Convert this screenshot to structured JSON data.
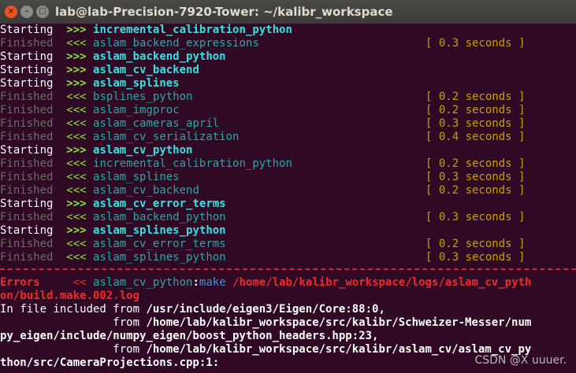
{
  "window": {
    "title": "lab@lab-Precision-7920-Tower: ~/kalibr_workspace",
    "close_icon": "×",
    "minimize_icon": "–",
    "maximize_icon": "□"
  },
  "colors": {
    "background": "#300a24",
    "accent_green": "#8ae234",
    "cyan": "#34e2e2",
    "error_red": "#ef2929",
    "seconds_yellow": "#c4a000"
  },
  "build_lines": [
    {
      "status": "Starting",
      "arrow": ">>>",
      "package": "incremental_calibration_python",
      "time": ""
    },
    {
      "status": "Finished",
      "arrow": "<<<",
      "package": "aslam_backend_expressions",
      "time": "[ 0.3 seconds ]"
    },
    {
      "status": "Starting",
      "arrow": ">>>",
      "package": "aslam_backend_python",
      "time": ""
    },
    {
      "status": "Starting",
      "arrow": ">>>",
      "package": "aslam_cv_backend",
      "time": ""
    },
    {
      "status": "Starting",
      "arrow": ">>>",
      "package": "aslam_splines",
      "time": ""
    },
    {
      "status": "Finished",
      "arrow": "<<<",
      "package": "bsplines_python",
      "time": "[ 0.2 seconds ]"
    },
    {
      "status": "Finished",
      "arrow": "<<<",
      "package": "aslam_imgproc",
      "time": "[ 0.2 seconds ]"
    },
    {
      "status": "Finished",
      "arrow": "<<<",
      "package": "aslam_cameras_april",
      "time": "[ 0.3 seconds ]"
    },
    {
      "status": "Finished",
      "arrow": "<<<",
      "package": "aslam_cv_serialization",
      "time": "[ 0.4 seconds ]"
    },
    {
      "status": "Starting",
      "arrow": ">>>",
      "package": "aslam_cv_python",
      "time": ""
    },
    {
      "status": "Finished",
      "arrow": "<<<",
      "package": "incremental_calibration_python",
      "time": "[ 0.2 seconds ]"
    },
    {
      "status": "Finished",
      "arrow": "<<<",
      "package": "aslam_splines",
      "time": "[ 0.3 seconds ]"
    },
    {
      "status": "Finished",
      "arrow": "<<<",
      "package": "aslam_cv_backend",
      "time": "[ 0.2 seconds ]"
    },
    {
      "status": "Starting",
      "arrow": ">>>",
      "package": "aslam_cv_error_terms",
      "time": ""
    },
    {
      "status": "Finished",
      "arrow": "<<<",
      "package": "aslam_backend_python",
      "time": "[ 0.3 seconds ]"
    },
    {
      "status": "Starting",
      "arrow": ">>>",
      "package": "aslam_splines_python",
      "time": ""
    },
    {
      "status": "Finished",
      "arrow": "<<<",
      "package": "aslam_cv_error_terms",
      "time": "[ 0.2 seconds ]"
    },
    {
      "status": "Finished",
      "arrow": "<<<",
      "package": "aslam_splines_python",
      "time": "[ 0.3 seconds ]"
    }
  ],
  "error": {
    "label": "Errors",
    "arrow": "<<",
    "package": "aslam_cv_python",
    "colon": ":",
    "target": "make",
    "path_line1": "/home/lab/kalibr_workspace/logs/aslam_cv_pyth",
    "path_line2": "on/build.make.002.log"
  },
  "output_lines": [
    {
      "prefix": "In file included from ",
      "path": "/usr/include/eigen3/Eigen/Core:88:0,"
    },
    {
      "prefix": "                 from ",
      "path": "/home/lab/kalibr_workspace/src/kalibr/Schweizer-Messer/num"
    },
    {
      "prefix": "",
      "path": "py_eigen/include/numpy_eigen/boost_python_headers.hpp:23,"
    },
    {
      "prefix": "                 from ",
      "path": "/home/lab/kalibr_workspace/src/kalibr/aslam_cv/aslam_cv_py"
    },
    {
      "prefix": "",
      "path": "thon/src/CameraProjections.cpp:1:"
    }
  ],
  "watermark": "CSDN @X uuuer."
}
